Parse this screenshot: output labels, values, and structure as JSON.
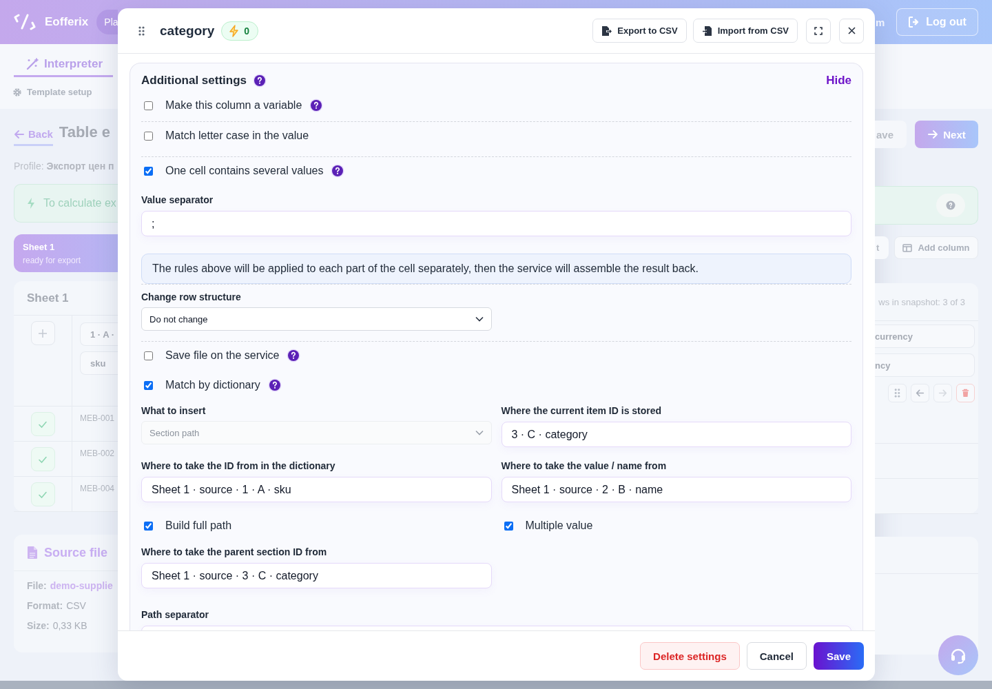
{
  "background": {
    "header": {
      "logo": "Eofferix",
      "plan_fragment": "Pla",
      "nav_fragment": "m",
      "logout": "Log out"
    },
    "left": {
      "tab": "Interpreter",
      "subnav": "Template setup",
      "back": "Back",
      "title": "Table e",
      "profile_label": "Profile:",
      "profile_value": "Экспорт цен п",
      "hint": "To calculate ex",
      "sheet_tab": {
        "title": "Sheet 1",
        "status": "ready for export"
      },
      "sheet_card": {
        "title": "Sheet 1",
        "column_chip": "1 · A ·",
        "column_name": "sku",
        "rows": [
          {
            "value": "MEB-001",
            "valid": true
          },
          {
            "value": "MEB-002",
            "valid": true
          },
          {
            "value": "MEB-004",
            "valid": true
          }
        ]
      },
      "source_card": {
        "title": "Source file",
        "fields": [
          {
            "label": "File:",
            "value": "demo-supplie",
            "kind": "link"
          },
          {
            "label": "Format:",
            "value": "CSV",
            "kind": "text"
          },
          {
            "label": "Size:",
            "value": "0,33 KB",
            "kind": "text"
          }
        ]
      }
    },
    "right": {
      "save_fragment": "ave",
      "next": "Next",
      "toolbar_fragment": "t",
      "add_column": "Add column",
      "snapshot": "ws in snapshot: 3 of 3",
      "chips": [
        "currency",
        "ncy"
      ]
    }
  },
  "modal": {
    "title": "category",
    "badge": "0",
    "actions": [
      {
        "label": "Export to CSV",
        "kind": "export"
      },
      {
        "label": "Import from CSV",
        "kind": "import"
      }
    ],
    "settings": {
      "title": "Additional settings",
      "help": true,
      "toggle": "Hide",
      "items": [
        {
          "kind": "checkbox",
          "label": "Make this column a variable",
          "checked": false,
          "help": true
        },
        {
          "kind": "divider"
        },
        {
          "kind": "checkbox",
          "label": "Match letter case in the value",
          "checked": false,
          "help": false
        },
        {
          "kind": "divider"
        },
        {
          "kind": "checkbox",
          "label": "One cell contains several values",
          "checked": true,
          "help": true
        },
        {
          "kind": "field",
          "label": "Value separator",
          "value": ";"
        },
        {
          "kind": "note",
          "text": "The rules above will be applied to each part of the cell separately, then the service will assemble the result back."
        },
        {
          "kind": "divider"
        },
        {
          "kind": "row",
          "cells": [
            {
              "kind": "select",
              "label": "Change row structure",
              "value": "Do not change",
              "disabled": false
            }
          ]
        },
        {
          "kind": "divider"
        },
        {
          "kind": "checkbox",
          "label": "Save file on the service",
          "checked": false,
          "help": true
        },
        {
          "kind": "checkbox",
          "label": "Match by dictionary",
          "checked": true,
          "help": true
        },
        {
          "kind": "row",
          "cells": [
            {
              "kind": "select",
              "label": "What to insert",
              "value": "Section path",
              "disabled": true
            },
            {
              "kind": "field",
              "label": "Where the current item ID is stored",
              "value": "3 · C · category"
            }
          ]
        },
        {
          "kind": "row",
          "cells": [
            {
              "kind": "field",
              "label": "Where to take the ID from in the dictionary",
              "value": "Sheet 1 · source · 1 · A · sku"
            },
            {
              "kind": "field",
              "label": "Where to take the value / name from",
              "value": "Sheet 1 · source · 2 · B · name"
            }
          ]
        },
        {
          "kind": "row",
          "cells": [
            {
              "kind": "checkbox",
              "label": "Build full path",
              "checked": true,
              "help": false
            },
            {
              "kind": "checkbox",
              "label": "Multiple value",
              "checked": true,
              "help": false
            }
          ]
        },
        {
          "kind": "row",
          "cells": [
            {
              "kind": "field",
              "label": "Where to take the parent section ID from",
              "value": "Sheet 1 · source · 3 · C · category"
            }
          ]
        },
        {
          "kind": "field",
          "label": "Path separator"
        }
      ]
    },
    "footer": [
      {
        "label": "Delete settings",
        "kind": "danger"
      },
      {
        "label": "Cancel",
        "kind": "secondary"
      },
      {
        "label": "Save",
        "kind": "primary"
      }
    ]
  }
}
